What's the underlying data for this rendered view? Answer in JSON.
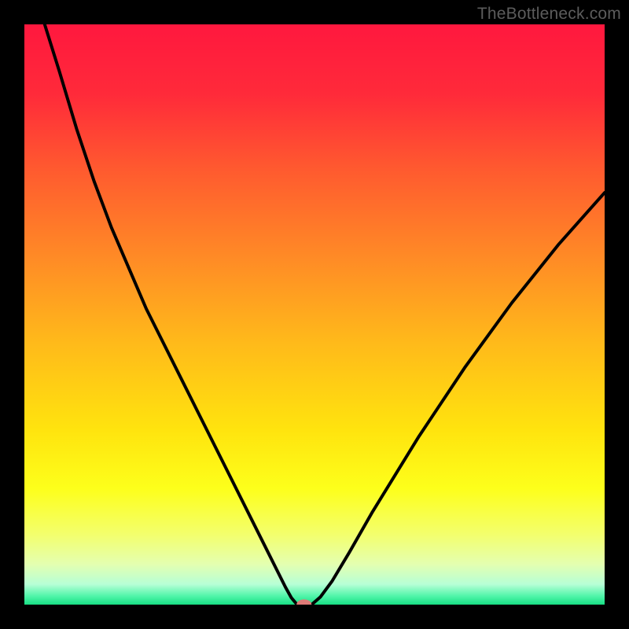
{
  "watermark": "TheBottleneck.com",
  "chart_data": {
    "type": "line",
    "title": "",
    "xlabel": "",
    "ylabel": "",
    "xlim": [
      0,
      100
    ],
    "ylim": [
      0,
      100
    ],
    "grid": false,
    "background_gradient": {
      "orientation": "vertical",
      "stops": [
        {
          "pos": 0.0,
          "color": "#ff183e"
        },
        {
          "pos": 0.12,
          "color": "#ff2a3a"
        },
        {
          "pos": 0.25,
          "color": "#ff5a2f"
        },
        {
          "pos": 0.4,
          "color": "#ff8a26"
        },
        {
          "pos": 0.55,
          "color": "#ffba1a"
        },
        {
          "pos": 0.7,
          "color": "#ffe40e"
        },
        {
          "pos": 0.8,
          "color": "#fdff1b"
        },
        {
          "pos": 0.88,
          "color": "#f3ff6e"
        },
        {
          "pos": 0.93,
          "color": "#e4ffb0"
        },
        {
          "pos": 0.965,
          "color": "#b7ffd6"
        },
        {
          "pos": 0.985,
          "color": "#51f5aa"
        },
        {
          "pos": 1.0,
          "color": "#18df84"
        }
      ]
    },
    "series": [
      {
        "name": "bottleneck-curve",
        "x": [
          3.5,
          6,
          9,
          12,
          15,
          18,
          21,
          24,
          27,
          30,
          33,
          36,
          39,
          41.5,
          43.5,
          45,
          46,
          47,
          49.5,
          51,
          53,
          56,
          60,
          64,
          68,
          72,
          76,
          80,
          84,
          88,
          92,
          96,
          100
        ],
        "y": [
          100,
          92,
          82,
          73,
          65,
          58,
          51,
          45,
          39,
          33,
          27,
          21,
          15,
          10,
          6,
          3,
          1.2,
          0,
          0,
          1.3,
          4,
          9,
          16,
          22.5,
          29,
          35,
          41,
          46.5,
          52,
          57,
          62,
          66.5,
          71
        ]
      }
    ],
    "marker": {
      "name": "vertex-marker",
      "x": 48.2,
      "y": 0,
      "color": "#de7a77",
      "rx": 1.3,
      "ry": 0.9
    }
  }
}
